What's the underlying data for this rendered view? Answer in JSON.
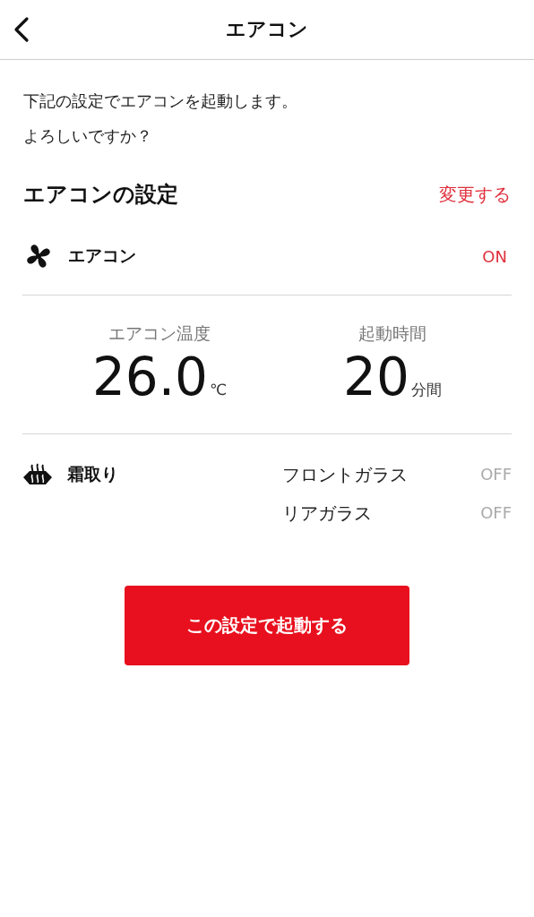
{
  "header": {
    "title": "エアコン"
  },
  "message": [
    "下記の設定でエアコンを起動します。",
    "よろしいですか？"
  ],
  "settings": {
    "title": "エアコンの設定",
    "change_link": "変更する",
    "aircon": {
      "label": "エアコン",
      "value": "ON",
      "on": true
    },
    "readings": [
      {
        "label": "エアコン温度",
        "value": "26.0",
        "unit": "℃"
      },
      {
        "label": "起動時間",
        "value": "20",
        "unit": "分間"
      }
    ],
    "defrost": {
      "label": "霜取り",
      "items": [
        {
          "label": "フロントガラス",
          "value": "OFF",
          "on": false
        },
        {
          "label": "リアガラス",
          "value": "OFF",
          "on": false
        }
      ]
    }
  },
  "start_button": "この設定で起動する"
}
